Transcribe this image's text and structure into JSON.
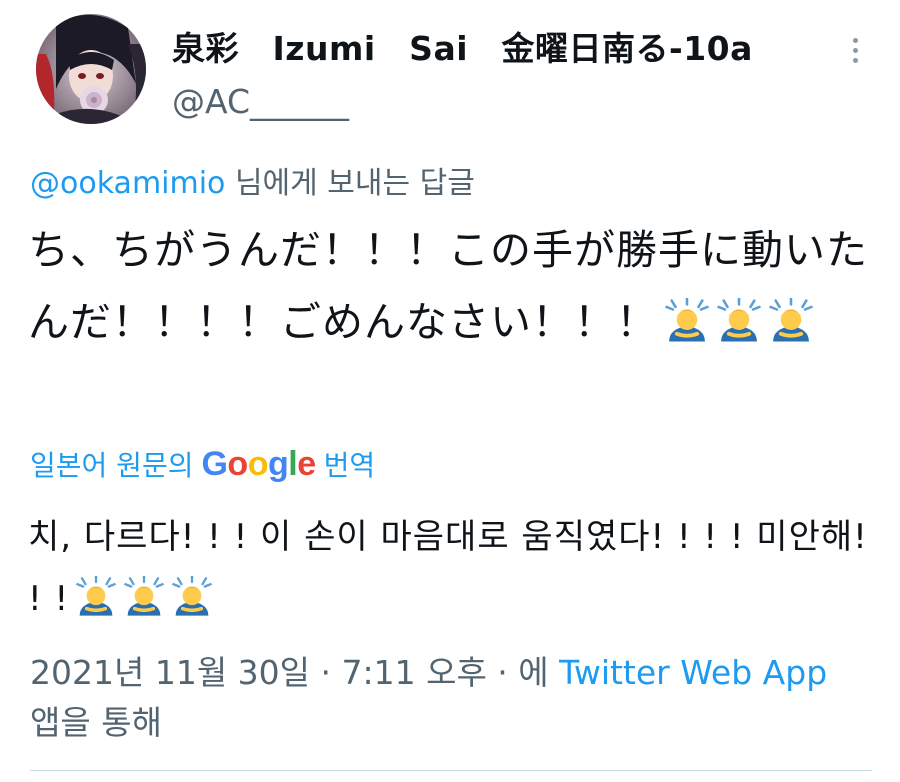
{
  "author": {
    "display_name": "泉彩　Izumi　Sai　金曜日南る-10a",
    "handle": "@AC______"
  },
  "reply": {
    "mention": "@ookamimio",
    "suffix": " 님에게 보내는 답글"
  },
  "tweet": {
    "original_text": "ち、ちがうんだ！！！この手が勝手に動いたんだ！！！！ごめんなさい！！！",
    "translated_text": "치, 다르다! ! ! 이 손이 마음대로 움직였다! ! ! ! 미안해! ! !",
    "emoji_name": "person-bowing-emoji"
  },
  "translation": {
    "prefix": "일본어 원문의",
    "provider": "Google",
    "suffix": "번역"
  },
  "meta": {
    "timestamp": "2021년 11월 30일 · 7:11 오후 · 에 ",
    "app": "Twitter Web App",
    "app_suffix": "앱을 통해"
  },
  "colors": {
    "link": "#1d9bf0",
    "secondary_text": "#536471",
    "primary_text": "#0f1419"
  }
}
